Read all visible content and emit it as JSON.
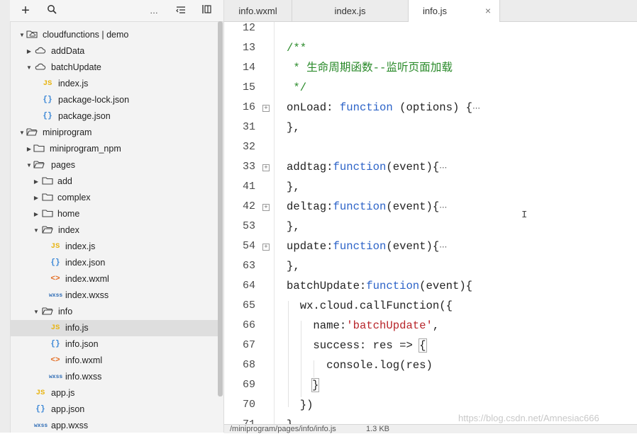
{
  "toolbar": {
    "add_icon": "+",
    "search_icon": "search-icon",
    "more_icon": "…",
    "collapse_icon": "collapse-icon",
    "split_icon": "split-icon"
  },
  "tree": {
    "items": [
      {
        "label": "cloudfunctions | demo",
        "icon": "cloud-folder",
        "arrow": "▼"
      },
      {
        "label": "addData",
        "icon": "cloud",
        "arrow": "▶"
      },
      {
        "label": "batchUpdate",
        "icon": "cloud",
        "arrow": "▼"
      },
      {
        "label": "index.js",
        "icon": "JS"
      },
      {
        "label": "package-lock.json",
        "icon": "{}"
      },
      {
        "label": "package.json",
        "icon": "{}"
      },
      {
        "label": "miniprogram",
        "icon": "folder-open",
        "arrow": "▼"
      },
      {
        "label": "miniprogram_npm",
        "icon": "folder",
        "arrow": "▶"
      },
      {
        "label": "pages",
        "icon": "folder-open",
        "arrow": "▼"
      },
      {
        "label": "add",
        "icon": "folder",
        "arrow": "▶"
      },
      {
        "label": "complex",
        "icon": "folder",
        "arrow": "▶"
      },
      {
        "label": "home",
        "icon": "folder",
        "arrow": "▶"
      },
      {
        "label": "index",
        "icon": "folder-open",
        "arrow": "▼"
      },
      {
        "label": "index.js",
        "icon": "JS"
      },
      {
        "label": "index.json",
        "icon": "{}"
      },
      {
        "label": "index.wxml",
        "icon": "<>"
      },
      {
        "label": "index.wxss",
        "icon": "wxss"
      },
      {
        "label": "info",
        "icon": "folder-open",
        "arrow": "▼"
      },
      {
        "label": "info.js",
        "icon": "JS"
      },
      {
        "label": "info.json",
        "icon": "{}"
      },
      {
        "label": "info.wxml",
        "icon": "<>"
      },
      {
        "label": "info.wxss",
        "icon": "wxss"
      },
      {
        "label": "app.js",
        "icon": "JS"
      },
      {
        "label": "app.json",
        "icon": "{}"
      },
      {
        "label": "app.wxss",
        "icon": "wxss"
      }
    ]
  },
  "tabs": [
    {
      "label": "info.wxml"
    },
    {
      "label": "index.js"
    },
    {
      "label": "info.js",
      "close": "×"
    }
  ],
  "gutter": {
    "line_numbers": [
      "12",
      "13",
      "14",
      "15",
      "16",
      "31",
      "32",
      "33",
      "41",
      "42",
      "53",
      "54",
      "63",
      "64",
      "65",
      "66",
      "67",
      "68",
      "69",
      "70",
      "71"
    ]
  },
  "code": {
    "l13": "/**",
    "l14": " * 生命周期函数--监听页面加载",
    "l15": " */",
    "l16_a": "onLoad: ",
    "l16_kw": "function",
    "l16_b": " (options) {",
    "l31": "},",
    "l33_a": "addtag:",
    "l33_kw": "function",
    "l33_b": "(event){",
    "l41": "},",
    "l42_a": "deltag:",
    "l42_kw": "function",
    "l42_b": "(event){",
    "l53": "},",
    "l54_a": "update:",
    "l54_kw": "function",
    "l54_b": "(event){",
    "l63": "},",
    "l64_a": "batchUpdate:",
    "l64_kw": "function",
    "l64_b": "(event){",
    "l65": "  wx.cloud.callFunction({",
    "l66_a": "    name:",
    "l66_str": "'batchUpdate'",
    "l66_b": ",",
    "l67_a": "    success: res => ",
    "l67_b": "{",
    "l68": "      console.log(res)",
    "l69": "}",
    "l70": "  })",
    "l71": "},",
    "ellipsis": "⋯"
  },
  "status": {
    "path": "/miniprogram/pages/info/info.js",
    "size": "1.3 KB"
  },
  "watermark": "https://blog.csdn.net/Amnesiac666"
}
